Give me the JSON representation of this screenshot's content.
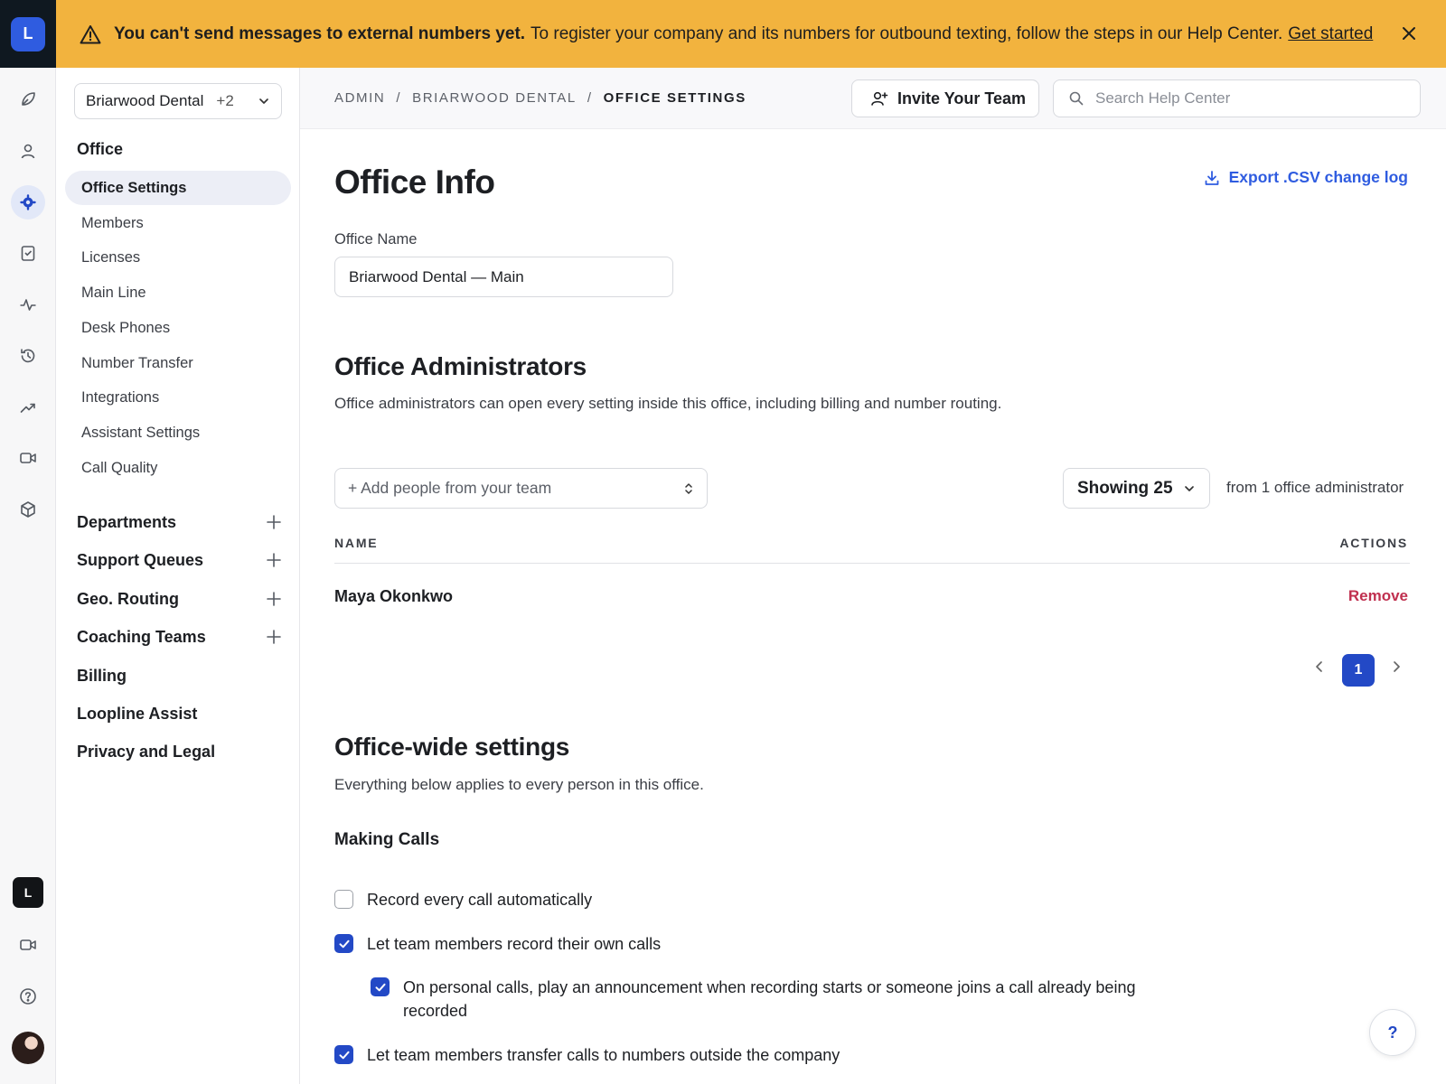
{
  "app": {
    "logo_letter": "L"
  },
  "banner": {
    "strong": "You can't send messages to external numbers yet.",
    "text": "To register your company and its numbers for outbound texting, follow the steps in our Help Center.",
    "link": "Get started"
  },
  "rail": {
    "items": [
      "rocket-icon",
      "person-icon",
      "gear-icon",
      "checklist-icon",
      "activity-icon",
      "history-icon",
      "trend-icon",
      "video-icon",
      "cube-icon"
    ],
    "active": "gear-icon",
    "badge_letter": "L"
  },
  "office_switcher": {
    "name": "Briarwood Dental",
    "extra": "+2"
  },
  "sidebar": {
    "section": "Office",
    "items": [
      "Office Settings",
      "Members",
      "Licenses",
      "Main Line",
      "Desk Phones",
      "Number Transfer",
      "Integrations",
      "Assistant Settings",
      "Call Quality"
    ],
    "groups": [
      "Departments",
      "Support Queues",
      "Geo. Routing",
      "Coaching Teams"
    ],
    "links": [
      "Billing",
      "Loopline Assist",
      "Privacy and Legal"
    ]
  },
  "header": {
    "breadcrumb": [
      "ADMIN",
      "BRIARWOOD DENTAL",
      "OFFICE SETTINGS"
    ],
    "invite_label": "Invite Your Team",
    "search_placeholder": "Search Help Center"
  },
  "main": {
    "title": "Office Info",
    "export_label": "Export .CSV change log",
    "office_name_label": "Office Name",
    "office_name_value": "Briarwood Dental — Main",
    "admins": {
      "title": "Office Administrators",
      "description": "Office administrators can open every setting inside this office, including billing and number routing.",
      "add_placeholder": "+ Add people from your team",
      "showing_label": "Showing 25",
      "from_text": "from 1 office administrator",
      "col_name": "NAME",
      "col_actions": "ACTIONS",
      "rows": [
        {
          "name": "Maya Okonkwo",
          "action": "Remove"
        }
      ],
      "page": "1"
    },
    "office_wide": {
      "title": "Office-wide settings",
      "description": "Everything below applies to every person in this office.",
      "making_calls": "Making Calls",
      "options": [
        {
          "label": "Record every call automatically",
          "checked": false
        },
        {
          "label": "Let team members record their own calls",
          "checked": true
        },
        {
          "label": "On personal calls, play an announcement when recording starts or someone joins a call already being recorded",
          "checked": true
        },
        {
          "label": "Let team members transfer calls to numbers outside the company",
          "checked": true
        }
      ]
    }
  },
  "help_button": "?",
  "colors": {
    "accent": "#2349c6",
    "banner": "#f2b33e",
    "danger": "#c0304f"
  }
}
